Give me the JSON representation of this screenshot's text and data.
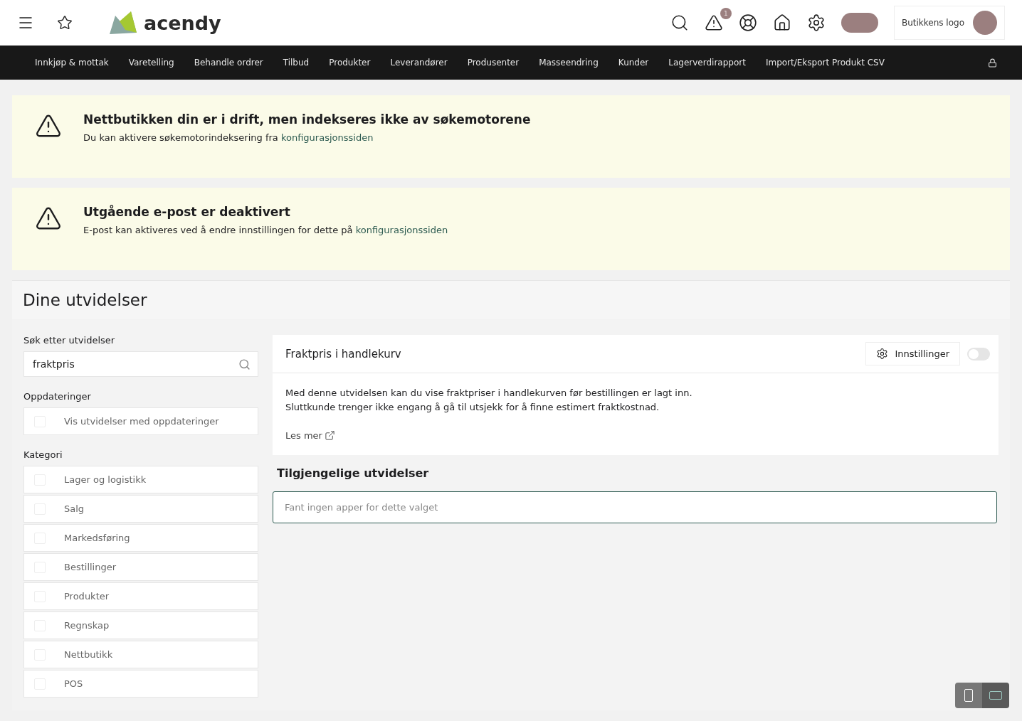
{
  "header": {
    "logo_text": "acendy",
    "alert_badge": "1",
    "store_logo_alt": "Butikkens logo"
  },
  "nav": [
    {
      "label": "Innkjøp & mottak"
    },
    {
      "label": "Varetelling"
    },
    {
      "label": "Behandle ordrer"
    },
    {
      "label": "Tilbud"
    },
    {
      "label": "Produkter"
    },
    {
      "label": "Leverandører"
    },
    {
      "label": "Produsenter"
    },
    {
      "label": "Masseendring"
    },
    {
      "label": "Kunder"
    },
    {
      "label": "Lagerverdirapport"
    },
    {
      "label": "Import/Eksport Produkt CSV"
    }
  ],
  "alerts": [
    {
      "title": "Nettbutikken din er i drift, men indekseres ikke av søkemotorene",
      "text": "Du kan aktivere søkemotorindeksering fra ",
      "link": "konfigurasjonssiden"
    },
    {
      "title": "Utgående e-post er deaktivert",
      "text": "E-post kan aktiveres ved å endre innstillingen for dette på ",
      "link": "konfigurasjonssiden"
    }
  ],
  "page": {
    "title": "Dine utvidelser"
  },
  "filters": {
    "search_label": "Søk etter utvidelser",
    "search_value": "fraktpris",
    "updates_label": "Oppdateringer",
    "updates": [
      {
        "label": "Vis utvidelser med oppdateringer",
        "checked": false
      }
    ],
    "category_label": "Kategori",
    "categories": [
      {
        "label": "Lager og logistikk",
        "checked": false
      },
      {
        "label": "Salg",
        "checked": false
      },
      {
        "label": "Markedsføring",
        "checked": false
      },
      {
        "label": "Bestillinger",
        "checked": false
      },
      {
        "label": "Produkter",
        "checked": false
      },
      {
        "label": "Regnskap",
        "checked": false
      },
      {
        "label": "Nettbutikk",
        "checked": false
      },
      {
        "label": "POS",
        "checked": false
      }
    ]
  },
  "extension": {
    "title": "Fraktpris i handlekurv",
    "settings_button": "Innstillinger",
    "on": false,
    "description": [
      "Med denne utvidelsen kan du vise fraktpriser i handlekurven før bestillingen er lagt inn.",
      "Sluttkunde trenger ikke engang å gå til utsjekk for å finne estimert fraktkostnad."
    ],
    "read_more": "Les mer"
  },
  "available": {
    "title": "Tilgjengelige utvidelser",
    "empty_text": "Fant ingen apper for dette valget"
  },
  "view_switch": [
    {
      "kind": "portrait",
      "selected": false
    },
    {
      "kind": "landscape",
      "selected": true
    }
  ]
}
